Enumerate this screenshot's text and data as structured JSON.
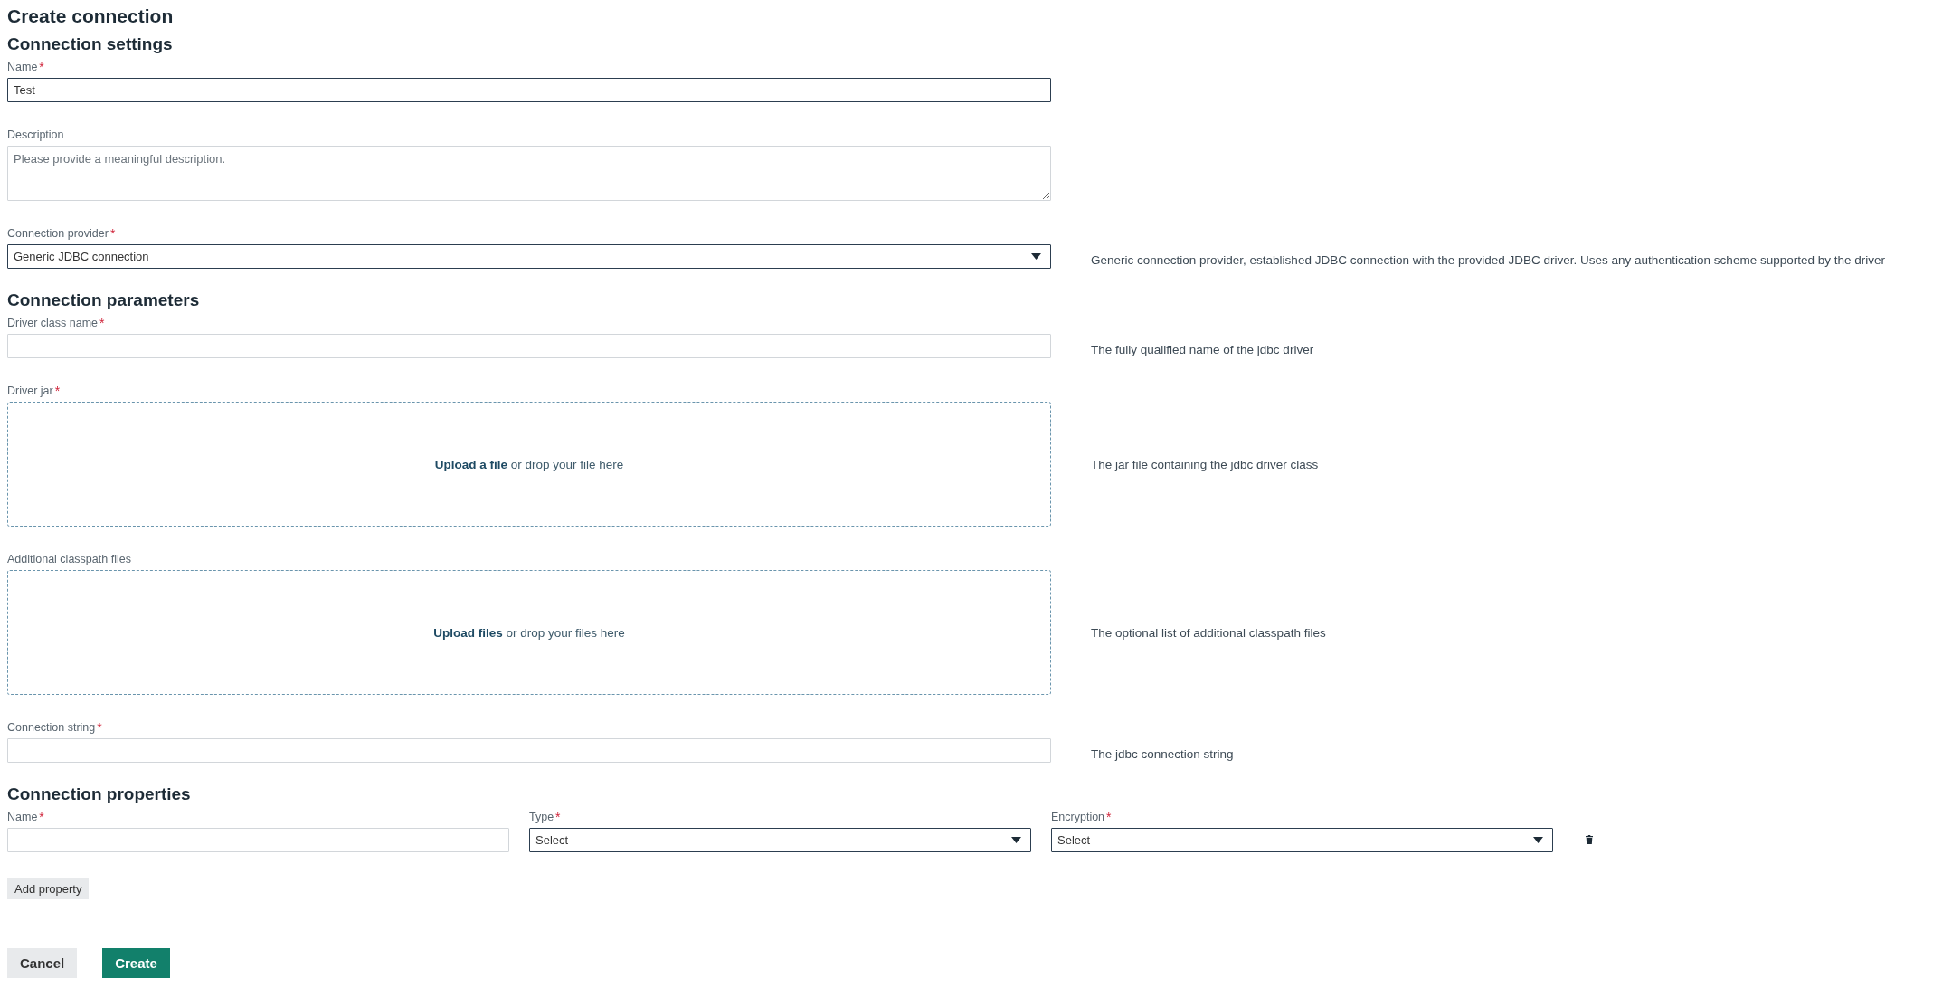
{
  "title": "Create connection",
  "sections": [
    {
      "heading": "Connection settings",
      "fields": [
        {
          "kind": "text",
          "label": "Name",
          "mark": "*",
          "value": "Test"
        },
        {
          "kind": "textarea",
          "label": "Description",
          "placeholder": "Please provide a meaningful description."
        },
        {
          "kind": "select",
          "label": "Connection provider",
          "mark": "*",
          "value": "Generic JDBC connection",
          "help": "Generic connection provider, established JDBC connection with the provided JDBC driver. Uses any authentication scheme supported by the driver"
        }
      ]
    },
    {
      "heading": "Connection parameters",
      "fields": [
        {
          "kind": "text",
          "label": "Driver class name",
          "mark": "*",
          "help": "The fully qualified name of the jdbc driver"
        },
        {
          "kind": "upload",
          "label": "Driver jar",
          "mark": "*",
          "link": "Upload a file",
          "text": "or drop your file here",
          "help": "The jar file containing the jdbc driver class"
        },
        {
          "kind": "upload",
          "label": "Additional classpath files",
          "link": "Upload files",
          "text": "or drop your files here",
          "help": "The optional list of additional classpath files"
        },
        {
          "kind": "text",
          "label": "Connection string",
          "mark": "*",
          "help": "The jdbc connection string"
        }
      ]
    }
  ],
  "properties": {
    "heading": "Connection properties",
    "columns": [
      {
        "kind": "text",
        "label": "Name",
        "mark": "*"
      },
      {
        "kind": "select",
        "label": "Type",
        "mark": "*",
        "value": "Select"
      },
      {
        "kind": "select",
        "label": "Encryption",
        "mark": "*",
        "value": "Select"
      }
    ],
    "add_button": "Add property"
  },
  "buttons": [
    {
      "label": "Cancel",
      "kind": "secondary"
    },
    {
      "label": "Create",
      "kind": "primary"
    }
  ]
}
